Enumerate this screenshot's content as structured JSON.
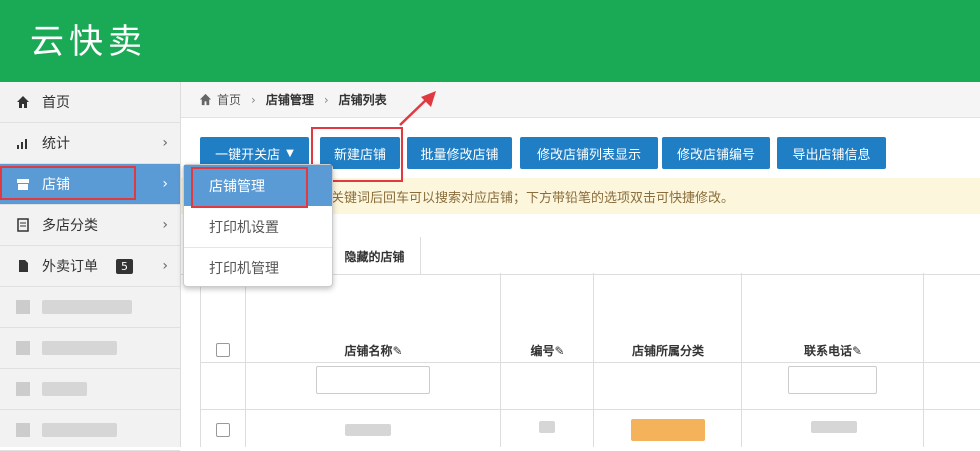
{
  "app": {
    "logo": "云快卖"
  },
  "sidebar": {
    "items": [
      {
        "label": "首页",
        "icon": "home-icon"
      },
      {
        "label": "统计",
        "icon": "bar-chart-icon"
      },
      {
        "label": "店铺",
        "icon": "store-icon"
      },
      {
        "label": "多店分类",
        "icon": "list-icon"
      },
      {
        "label": "外卖订单",
        "icon": "file-icon",
        "badge": "5"
      }
    ]
  },
  "breadcrumb": {
    "home": "首页",
    "level1": "店铺管理",
    "level2": "店铺列表"
  },
  "toolbar": {
    "one_click": "一键开关店",
    "new_store": "新建店铺",
    "batch_edit": "批量修改店铺",
    "edit_list_display": "修改店铺列表显示",
    "edit_store_no": "修改店铺编号",
    "export_info": "导出店铺信息"
  },
  "notice": {
    "text": "关键词后回车可以搜索对应店铺；下方带铅笔的选项双击可快捷修改。"
  },
  "tabs": {
    "hidden_stores": "隐藏的店铺"
  },
  "table": {
    "headers": {
      "store_name": "店铺名称",
      "number": "编号",
      "category": "店铺所属分类",
      "phone": "联系电话"
    }
  },
  "dropdown": {
    "items": [
      "店铺管理",
      "打印机设置",
      "打印机管理"
    ]
  },
  "colors": {
    "header_green": "#1aaa55",
    "primary_blue": "#1f7ec4",
    "active_blue": "#5b9bd5",
    "highlight_red": "#e0393f"
  }
}
